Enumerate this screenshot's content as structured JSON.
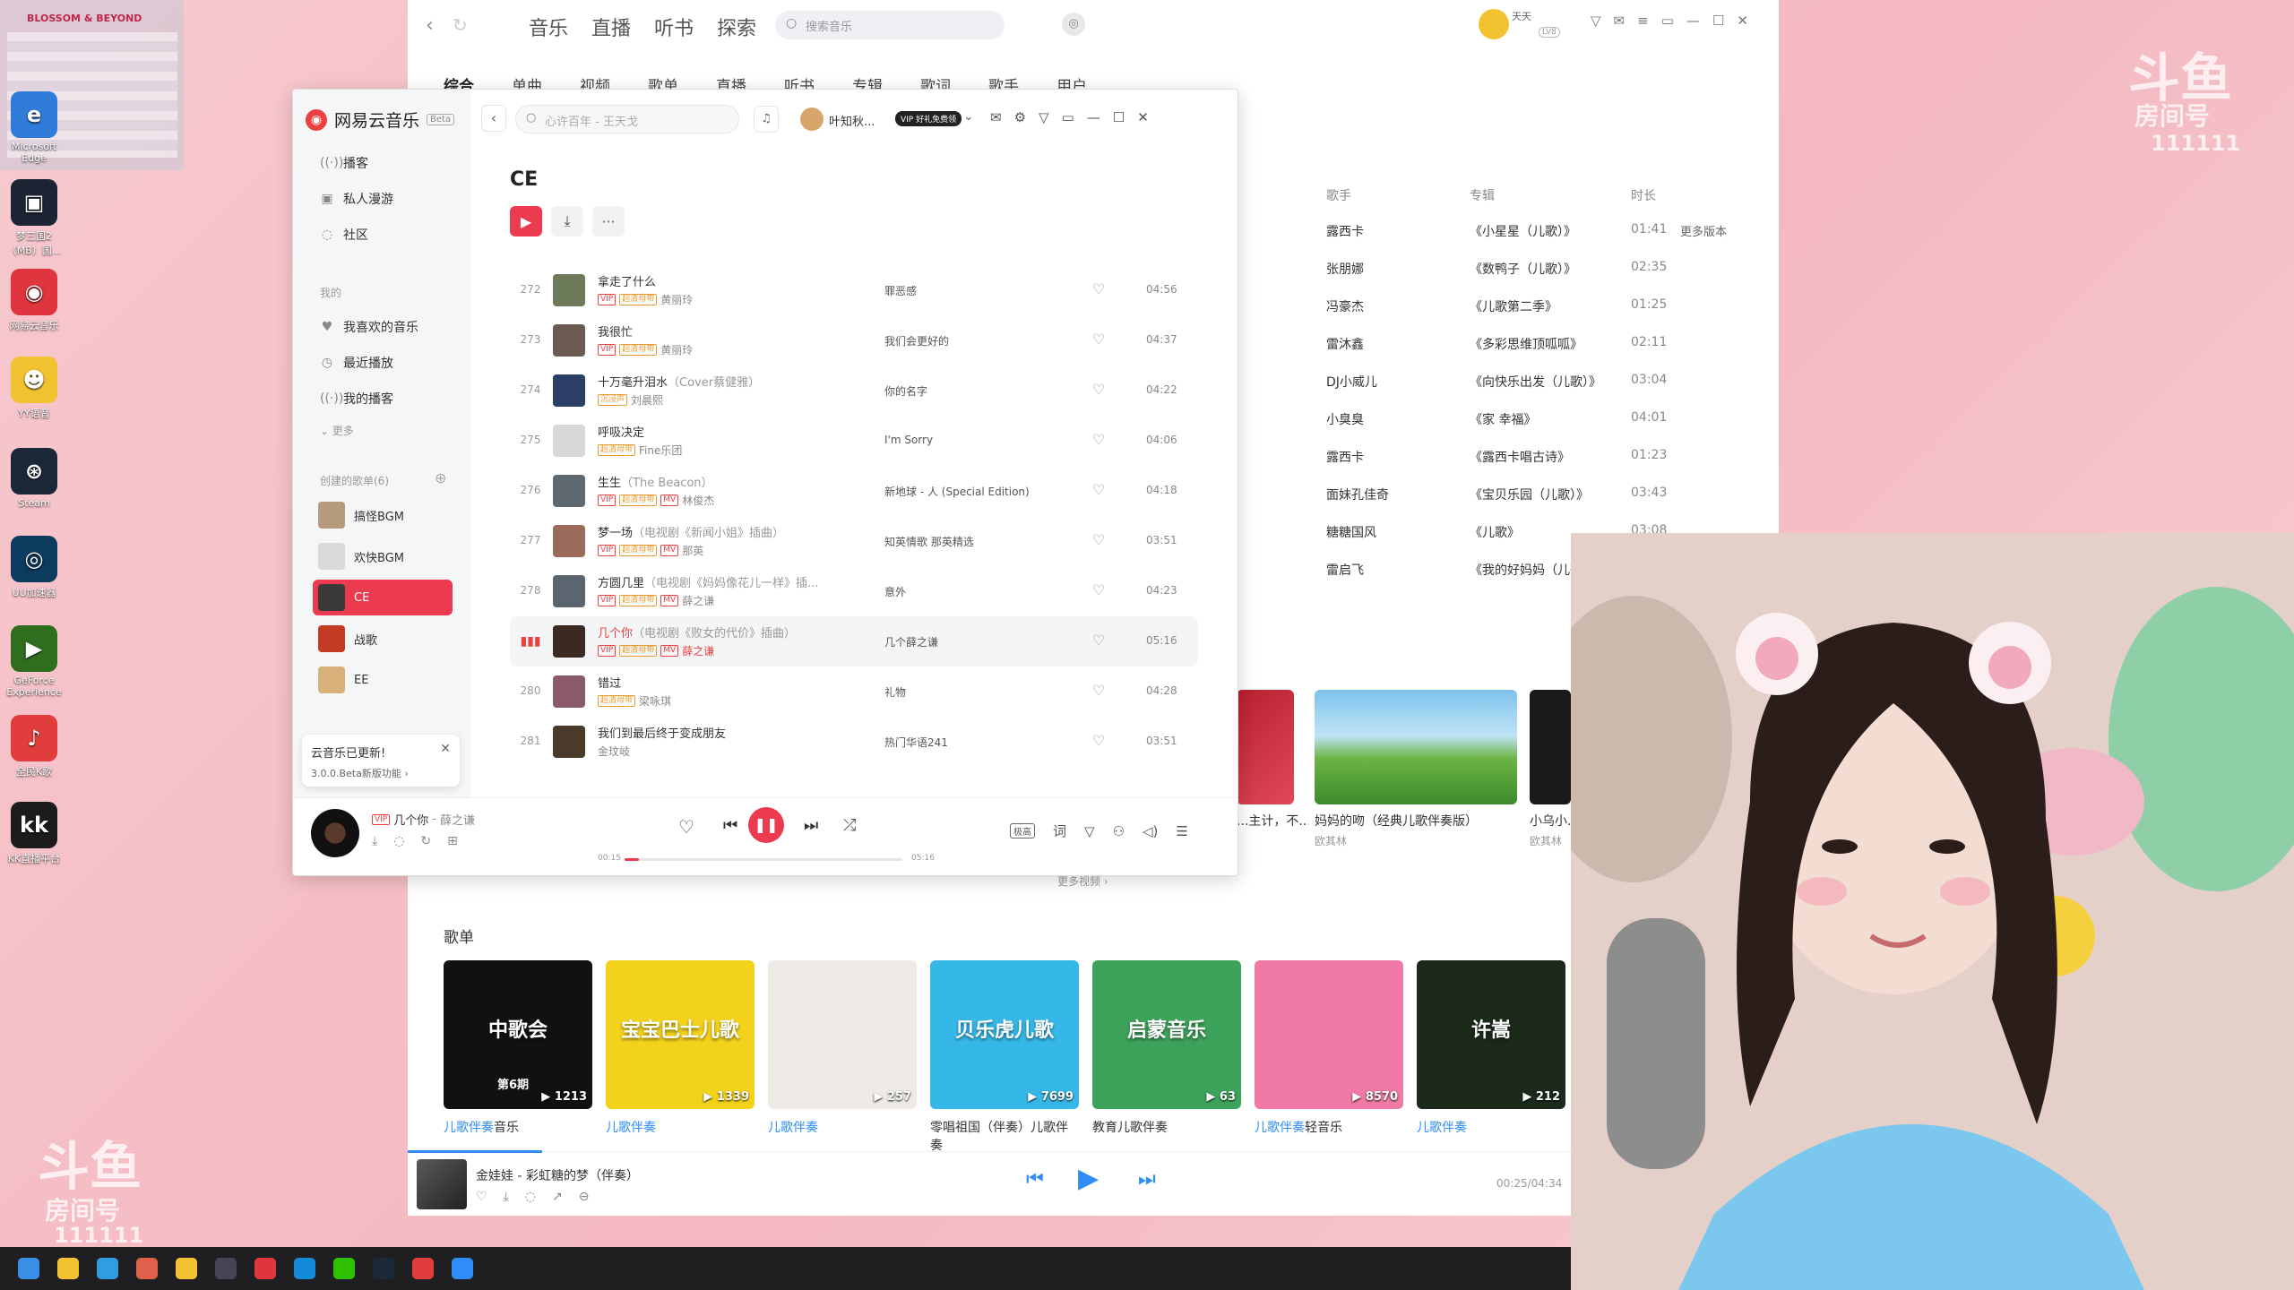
{
  "desktop": {
    "top_label": "BLOSSOM & BEYOND",
    "icons": [
      {
        "label": "Microsoft Edge",
        "color": "#2f7bd8"
      },
      {
        "label": "梦三国2（MB）国...",
        "color": "#1d2433"
      },
      {
        "label": "网易云音乐",
        "color": "#e0343f"
      },
      {
        "label": "YY语音",
        "color": "#f2c230"
      },
      {
        "label": "Steam",
        "color": "#1b2838"
      },
      {
        "label": "UU加速器",
        "color": "#0b3b5e"
      },
      {
        "label": "GeForce Experience",
        "color": "#2f6e1f"
      },
      {
        "label": "全民K歌",
        "color": "#e23d3d"
      },
      {
        "label": "KK直播平台",
        "color": "#1c1c1c"
      }
    ]
  },
  "watermark": {
    "brand": "斗鱼",
    "room_label": "房间号",
    "room_no": "111111"
  },
  "kugou": {
    "nav": [
      "音乐",
      "直播",
      "听书",
      "探索"
    ],
    "search_placeholder": "搜索音乐",
    "user": "天天",
    "user_level": "LV8",
    "tabs": [
      "综合",
      "单曲",
      "视频",
      "歌单",
      "直播",
      "听书",
      "专辑",
      "歌词",
      "歌手",
      "用户"
    ],
    "headers": {
      "singer": "歌手",
      "album": "专辑",
      "duration": "时长"
    },
    "rows": [
      {
        "singer": "露西卡",
        "album": "《小星星（儿歌）》",
        "duration": "01:41",
        "extra": "更多版本"
      },
      {
        "singer": "张朋娜",
        "album": "《数鸭子（儿歌）》",
        "duration": "02:35"
      },
      {
        "singer": "冯豪杰",
        "album": "《儿歌第二季》",
        "duration": "01:25"
      },
      {
        "singer": "雷沐鑫",
        "album": "《多彩思维顶呱呱》",
        "duration": "02:11"
      },
      {
        "singer": "DJ小威儿",
        "album": "《向快乐出发（儿歌）》",
        "duration": "03:04"
      },
      {
        "singer": "小臭臭",
        "album": "《家 幸福》",
        "duration": "04:01"
      },
      {
        "singer": "露西卡",
        "album": "《露西卡唱古诗》",
        "duration": "01:23"
      },
      {
        "singer": "面妹孔佳奇",
        "album": "《宝贝乐园（儿歌）》",
        "duration": "03:43"
      },
      {
        "singer": "糖糖国风",
        "album": "《儿歌》",
        "duration": "03:08"
      },
      {
        "singer": "雷启飞",
        "album": "《我的好妈妈（儿歌）》",
        "duration": ""
      }
    ],
    "videos": [
      {
        "title": "...主计，不...",
        "artist": ""
      },
      {
        "title": "妈妈的吻（经典儿歌伴奏版）",
        "artist": "欧其林"
      },
      {
        "title": "小乌小...",
        "artist": "欧其林"
      }
    ],
    "more_videos": "更多视频 ›",
    "playlist_section": "歌单",
    "playlists": [
      {
        "cover_text": "中歌会",
        "badge": "第6期",
        "count": "1213",
        "name_a": "儿歌伴奏",
        "name_b": "音乐",
        "color": "#111"
      },
      {
        "cover_text": "宝宝巴士儿歌",
        "count": "1339",
        "name_a": "儿歌伴奏",
        "name_b": "",
        "color": "#f3d21c"
      },
      {
        "cover_text": "",
        "count": "257",
        "name_a": "儿歌伴奏",
        "name_b": "",
        "color": "#eeeae6"
      },
      {
        "cover_text": "贝乐虎儿歌",
        "count": "7699",
        "name_a": "",
        "name_b": "零唱祖国（伴奏）儿歌伴奏",
        "color": "#35b8e8"
      },
      {
        "cover_text": "启蒙音乐",
        "count": "63",
        "name_a": "",
        "name_b": "教育儿歌伴奏",
        "color": "#3ea35a"
      },
      {
        "cover_text": "",
        "count": "8570",
        "name_a": "儿歌伴奏",
        "name_b": "轻音乐",
        "color": "#f07aa5"
      },
      {
        "cover_text": "许嵩",
        "count": "212",
        "name_a": "儿歌伴奏",
        "name_b": "",
        "color": "#1c2a1c"
      }
    ],
    "player": {
      "song": "金娃娃 - 彩虹糖的梦（伴奏）",
      "time": "00:25/04:34"
    }
  },
  "netease": {
    "app_name": "网易云音乐",
    "beta": "Beta",
    "nav": [
      {
        "icon": "podcast-icon",
        "label": "播客"
      },
      {
        "icon": "fm-icon",
        "label": "私人漫游"
      },
      {
        "icon": "community-icon",
        "label": "社区"
      }
    ],
    "my_label": "我的",
    "my_items": [
      {
        "icon": "heart-icon",
        "label": "我喜欢的音乐"
      },
      {
        "icon": "clock-icon",
        "label": "最近播放"
      },
      {
        "icon": "podcast-icon",
        "label": "我的播客"
      }
    ],
    "more": "更多",
    "created_label": "创建的歌单(6)",
    "playlists": [
      {
        "label": "搞怪BGM",
        "color": "#b59a7d"
      },
      {
        "label": "欢快BGM",
        "color": "#d9d9d9"
      },
      {
        "label": "CE",
        "color": "#3a3a3a"
      },
      {
        "label": "战歌",
        "color": "#c23b22"
      },
      {
        "label": "EE",
        "color": "#d8b07a"
      }
    ],
    "toast": {
      "title": "云音乐已更新!",
      "sub": "3.0.0.Beta新版功能 ›"
    },
    "search_placeholder": "心许百年 - 王天戈",
    "user": "叶知秋...",
    "vip": "VIP 好礼免费领",
    "title": "CE",
    "songs": [
      {
        "idx": "272",
        "title": "拿走了什么",
        "alias": "",
        "artist": "黄丽玲",
        "tags": [
          "VIP",
          "超清母带"
        ],
        "album": "罪恶感",
        "duration": "04:56",
        "color": "#6c7a5a"
      },
      {
        "idx": "273",
        "title": "我很忙",
        "alias": "",
        "artist": "黄丽玲",
        "tags": [
          "VIP",
          "超清母带"
        ],
        "album": "我们会更好的",
        "duration": "04:37",
        "color": "#6a5a52"
      },
      {
        "idx": "274",
        "title": "十万毫升泪水",
        "alias": "（Cover蔡健雅）",
        "artist": "刘晨熙",
        "tags": [
          "沉浸声"
        ],
        "album": "你的名字",
        "duration": "04:22",
        "color": "#2b3f66"
      },
      {
        "idx": "275",
        "title": "呼吸决定",
        "alias": "",
        "artist": "Fine乐团",
        "tags": [
          "超清母带"
        ],
        "album": "I'm Sorry",
        "duration": "04:06",
        "color": "#d8d8d8"
      },
      {
        "idx": "276",
        "title": "生生",
        "alias": "（The Beacon）",
        "artist": "林俊杰",
        "tags": [
          "VIP",
          "超清母带",
          "MV"
        ],
        "album": "新地球 - 人 (Special Edition)",
        "duration": "04:18",
        "color": "#5e6a70"
      },
      {
        "idx": "277",
        "title": "梦一场",
        "alias": "（电视剧《新闻小姐》插曲）",
        "artist": "那英",
        "tags": [
          "VIP",
          "超清母带",
          "MV"
        ],
        "album": "知英情歌 那英精选",
        "duration": "03:51",
        "color": "#9a6a5a"
      },
      {
        "idx": "278",
        "title": "方圆几里",
        "alias": "（电视剧《妈妈像花儿一样》插...",
        "artist": "薛之谦",
        "tags": [
          "VIP",
          "超清母带",
          "MV"
        ],
        "album": "意外",
        "duration": "04:23",
        "color": "#5a6570"
      },
      {
        "idx": "",
        "title": "几个你",
        "alias": "（电视剧《败女的代价》插曲）",
        "artist": "薛之谦",
        "tags": [
          "VIP",
          "超清母带",
          "MV"
        ],
        "album": "几个薛之谦",
        "duration": "05:16",
        "color": "#3a2a22",
        "playing": true
      },
      {
        "idx": "280",
        "title": "错过",
        "alias": "",
        "artist": "梁咏琪",
        "tags": [
          "超清母带"
        ],
        "album": "礼物",
        "duration": "04:28",
        "color": "#8a5a6a"
      },
      {
        "idx": "281",
        "title": "我们到最后终于变成朋友",
        "alias": "",
        "artist": "金玟岐",
        "tags": [],
        "album": "热门华语241",
        "duration": "03:51",
        "color": "#4a3a2a"
      }
    ],
    "player": {
      "song": "几个你",
      "artist": "薛之谦",
      "current": "00:15",
      "total": "05:16",
      "progress": 0.05,
      "quality": "极高"
    }
  }
}
